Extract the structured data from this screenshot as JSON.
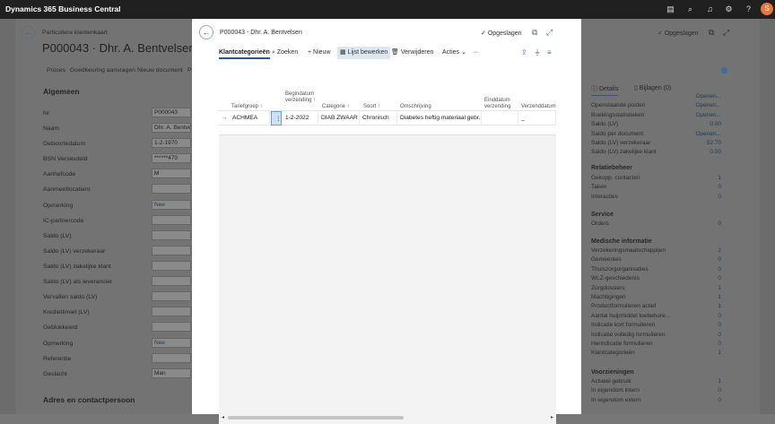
{
  "topbar": {
    "app_title": "Dynamics 365 Business Central",
    "avatar": "S",
    "icons": [
      "document-icon",
      "search-icon",
      "bell-icon",
      "gear-icon",
      "help-icon"
    ]
  },
  "bgpage": {
    "breadcrumb": "Particuliere klantenkaart",
    "title": "P000043 · Dhr. A. Bentvelsen",
    "saved": "Opgeslagen",
    "actions": [
      "Proces",
      "Goedkeuring aanvragen",
      "Nieuw document",
      "P"
    ],
    "section_general": "Algemeen",
    "section_address": "Adres en contactpersoon",
    "fields": [
      {
        "label": "Nr.",
        "value": "P000043"
      },
      {
        "label": "Naam",
        "value": "Dhr. A. Bentvel"
      },
      {
        "label": "Geboortedatum",
        "value": "1-2-1970"
      },
      {
        "label": "BSN Versleuteld",
        "value": "******470"
      },
      {
        "label": "Aanhefcode",
        "value": "M"
      },
      {
        "label": "Aanmeetlocatienr.",
        "value": ""
      },
      {
        "label": "Opmerking",
        "value": "Nee"
      },
      {
        "label": "IC-partnercode",
        "value": ""
      },
      {
        "label": "Saldo (LV)",
        "value": ""
      },
      {
        "label": "Saldo (LV) verzekeraar",
        "value": ""
      },
      {
        "label": "Saldo (LV) zakelijke klant",
        "value": ""
      },
      {
        "label": "Saldo (LV) als leverancier",
        "value": ""
      },
      {
        "label": "Vervallen saldo (LV)",
        "value": ""
      },
      {
        "label": "Kredietlimiet (LV)",
        "value": ""
      },
      {
        "label": "Geblokkeerd",
        "value": ""
      },
      {
        "label": "Opmerking",
        "value": "Nee"
      },
      {
        "label": "Referentie",
        "value": ""
      },
      {
        "label": "Geslacht",
        "value": "Man"
      }
    ]
  },
  "factbox": {
    "tab_details": "Details",
    "tab_attach": "Bijlagen (0)",
    "rows1": [
      {
        "l": "",
        "v": "Openen..."
      },
      {
        "l": "Openstaande posten",
        "v": "Openen..."
      },
      {
        "l": "Boekingsstatistieken",
        "v": "Openen..."
      },
      {
        "l": "Saldo (LV)",
        "v": "0.00"
      },
      {
        "l": "Saldo per document",
        "v": "Openen..."
      },
      {
        "l": "Saldo (LV) verzekeraar",
        "v": "52.70"
      },
      {
        "l": "Saldo (LV) zakelijke klant",
        "v": "0.00"
      }
    ],
    "h_relatie": "Relatiebeheer",
    "rows2": [
      {
        "l": "Gekopp. contacten",
        "v": "1"
      },
      {
        "l": "Taken",
        "v": "0"
      },
      {
        "l": "Interacties",
        "v": "0"
      }
    ],
    "h_service": "Service",
    "rows3": [
      {
        "l": "Orders",
        "v": "0"
      }
    ],
    "h_medisch": "Medische informatie",
    "rows4": [
      {
        "l": "Verzekeringsmaatschappijen",
        "v": "2"
      },
      {
        "l": "Gemeentes",
        "v": "0"
      },
      {
        "l": "Thuiszorgorganisaties",
        "v": "0"
      },
      {
        "l": "WLZ-geschiedenis",
        "v": "0"
      },
      {
        "l": "Zorgdossiers",
        "v": "1"
      },
      {
        "l": "Machtigingen",
        "v": "1"
      },
      {
        "l": "Productformulieren actief",
        "v": "1"
      },
      {
        "l": "Aantal hulpmiddel toebehore...",
        "v": "0"
      },
      {
        "l": "Indicatie kort formulieren",
        "v": "0"
      },
      {
        "l": "Indicatie volledig formulieren",
        "v": "0"
      },
      {
        "l": "Herindicatie formulieren",
        "v": "0"
      },
      {
        "l": "Klantcategorieën",
        "v": "1"
      }
    ],
    "h_voorz": "Voorzieningen",
    "rows5": [
      {
        "l": "Actueel gebruik",
        "v": "1"
      },
      {
        "l": "In eigendom intern",
        "v": "0"
      },
      {
        "l": "In eigendom extern",
        "v": "0"
      }
    ]
  },
  "dialog": {
    "title": "P000043 - Dhr. A. Bentvelsen",
    "saved": "Opgeslagen",
    "toolbar": {
      "page": "Klantcategorieën",
      "search": "Zoeken",
      "new": "Nieuw",
      "edit_list": "Lijst bewerken",
      "delete": "Verwijderen",
      "actions": "Acties",
      "more": "···"
    },
    "columns": {
      "tarief": "Tariefgroep ↑",
      "begin": "Begindatum verzending ↑",
      "cat": "Categorie ↑",
      "soort": "Soort ↑",
      "omschr": "Omschrijving",
      "eind": "Einddatum verzending",
      "verz": "Verzenddatum"
    },
    "row": {
      "tarief": "ACHMEA",
      "begin": "1-2-2022",
      "cat": "DIAB ZWAAR",
      "soort": "Chronisch",
      "omschr": "Diabetes heftig materiaal gebr...",
      "eind": "",
      "verz": "_"
    }
  }
}
